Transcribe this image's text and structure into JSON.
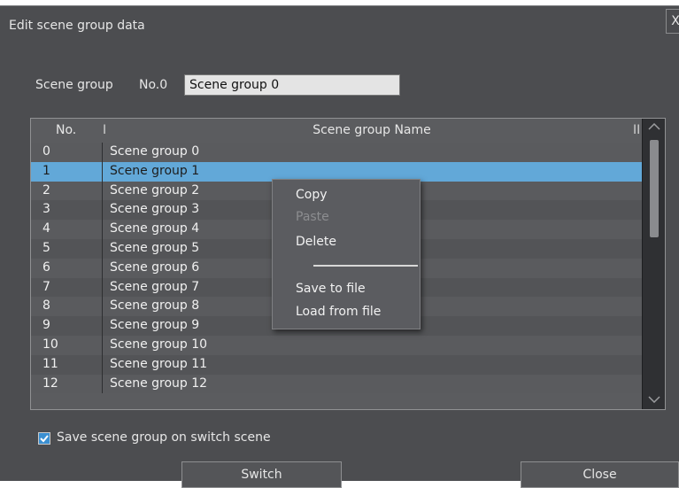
{
  "dialog": {
    "title": "Edit scene group data",
    "close_glyph": "X"
  },
  "scene_group": {
    "label": "Scene group",
    "number": "No.0",
    "name_value": "Scene group 0"
  },
  "table": {
    "col_no": "No.",
    "col_name": "Scene group Name",
    "separator1": "I",
    "separator2": "II",
    "selected_index": 1,
    "rows": [
      {
        "no": "0",
        "name": "Scene group 0"
      },
      {
        "no": "1",
        "name": "Scene group 1"
      },
      {
        "no": "2",
        "name": "Scene group 2"
      },
      {
        "no": "3",
        "name": "Scene group 3"
      },
      {
        "no": "4",
        "name": "Scene group 4"
      },
      {
        "no": "5",
        "name": "Scene group 5"
      },
      {
        "no": "6",
        "name": "Scene group 6"
      },
      {
        "no": "7",
        "name": "Scene group 7"
      },
      {
        "no": "8",
        "name": "Scene group 8"
      },
      {
        "no": "9",
        "name": "Scene group 9"
      },
      {
        "no": "10",
        "name": "Scene group 10"
      },
      {
        "no": "11",
        "name": "Scene group 11"
      },
      {
        "no": "12",
        "name": "Scene group 12"
      }
    ],
    "scroll_up_icon": "chevron-up-icon",
    "scroll_down_icon": "chevron-down-icon"
  },
  "context_menu": {
    "copy": "Copy",
    "paste": "Paste",
    "delete": "Delete",
    "save_to_file": "Save to file",
    "load_from_file": "Load from file"
  },
  "options": {
    "save_on_switch_label": "Save scene group on switch scene",
    "save_on_switch_checked": true
  },
  "buttons": {
    "switch": "Switch",
    "close": "Close"
  },
  "colors": {
    "dialog_bg": "#4c4d50",
    "selected_row": "#62a8d8",
    "checkbox_accent": "#3b8fd1"
  }
}
